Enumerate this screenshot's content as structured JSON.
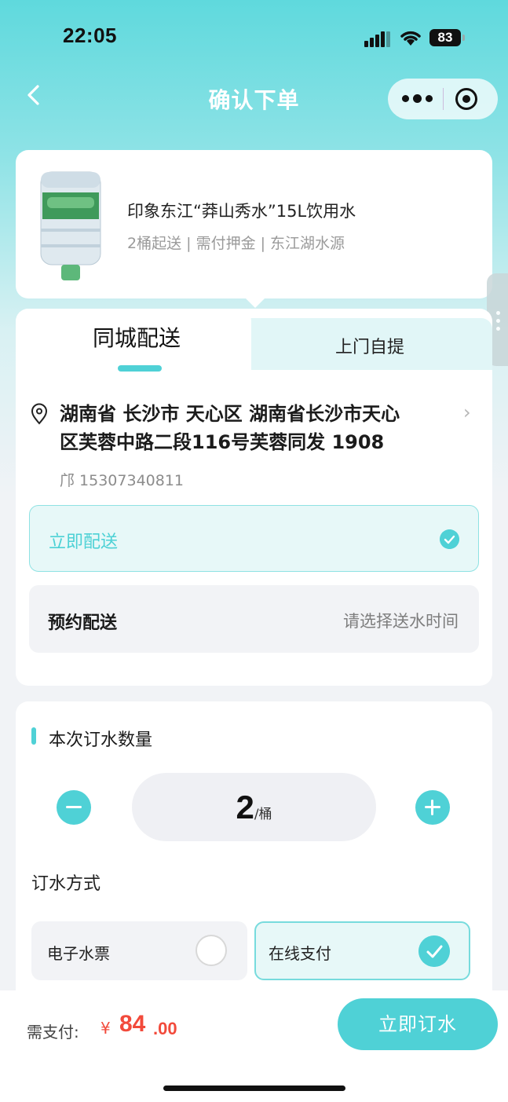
{
  "status_bar": {
    "time": "22:05",
    "battery": "83"
  },
  "nav": {
    "title": "确认下单"
  },
  "product": {
    "name": "印象东江“莽山秀水”15L饮用水",
    "desc": "2桶起送 | 需付押金 | 东江湖水源"
  },
  "delivery": {
    "tabs": [
      {
        "label": "同城配送",
        "active": true
      },
      {
        "label": "上门自提",
        "active": false
      }
    ],
    "address_line1": "湖南省 长沙市 天心区 湖南省长沙市天心",
    "address_line2": "区芙蓉中路二段116号芙蓉同发 1908",
    "contact": "邝 15307340811",
    "options": [
      {
        "label": "立即配送",
        "selected": true
      },
      {
        "label": "预约配送",
        "hint": "请选择送水时间"
      }
    ]
  },
  "quantity": {
    "title": "本次订水数量",
    "value": "2",
    "unit": "/桶",
    "method_title": "订水方式",
    "methods": [
      {
        "label": "电子水票",
        "selected": false
      },
      {
        "label": "在线支付",
        "selected": true
      }
    ]
  },
  "checkout": {
    "pay_label": "需支付:",
    "currency": "¥",
    "price_int": "84",
    "price_dec": ".00",
    "button": "立即订水"
  },
  "colors": {
    "accent": "#4fd1d6",
    "price": "#f24a3b",
    "header": "#5fd9dd"
  }
}
